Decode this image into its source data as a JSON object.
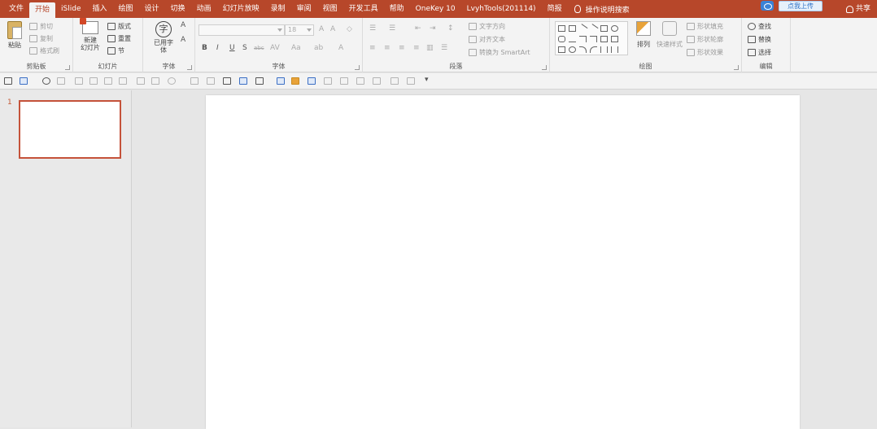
{
  "menu": {
    "tabs": [
      "文件",
      "开始",
      "iSlide",
      "插入",
      "绘图",
      "设计",
      "切换",
      "动画",
      "幻灯片放映",
      "录制",
      "审阅",
      "视图",
      "开发工具",
      "帮助",
      "OneKey 10",
      "LvyhTools(201114)",
      "简报"
    ],
    "active_tab": "开始",
    "tell_me": "操作说明搜索",
    "upload": "点我上传",
    "share": "共享"
  },
  "ribbon": {
    "clipboard": {
      "label": "剪贴板",
      "paste": "粘贴",
      "cut": "剪切",
      "copy": "复制",
      "format_painter": "格式刷"
    },
    "slides": {
      "label": "幻灯片",
      "new_slide_line1": "新建",
      "new_slide_line2": "幻灯片",
      "layout": "版式",
      "reset": "重置",
      "section": "节"
    },
    "ufont": {
      "label": "字体",
      "btn_line1": "已用字",
      "btn_line2": "体",
      "glyph": "字"
    },
    "font": {
      "label": "字体",
      "size": "18",
      "bold": "B",
      "italic": "I",
      "underline": "U",
      "shadow": "S",
      "strike": "abc",
      "spacing": "AV",
      "case": "Aa",
      "grow": "A",
      "shrink": "A"
    },
    "paragraph": {
      "label": "段落",
      "text_direction": "文字方向",
      "align_text": "对齐文本",
      "smartart": "转换为 SmartArt"
    },
    "drawing": {
      "label": "绘图",
      "arrange": "排列",
      "quick_styles": "快速样式",
      "fill": "形状填充",
      "outline": "形状轮廓",
      "effects": "形状效果"
    },
    "editing": {
      "label": "编辑",
      "find": "查找",
      "replace": "替换",
      "select": "选择"
    }
  },
  "slides_pane": {
    "slide_number": "1"
  }
}
